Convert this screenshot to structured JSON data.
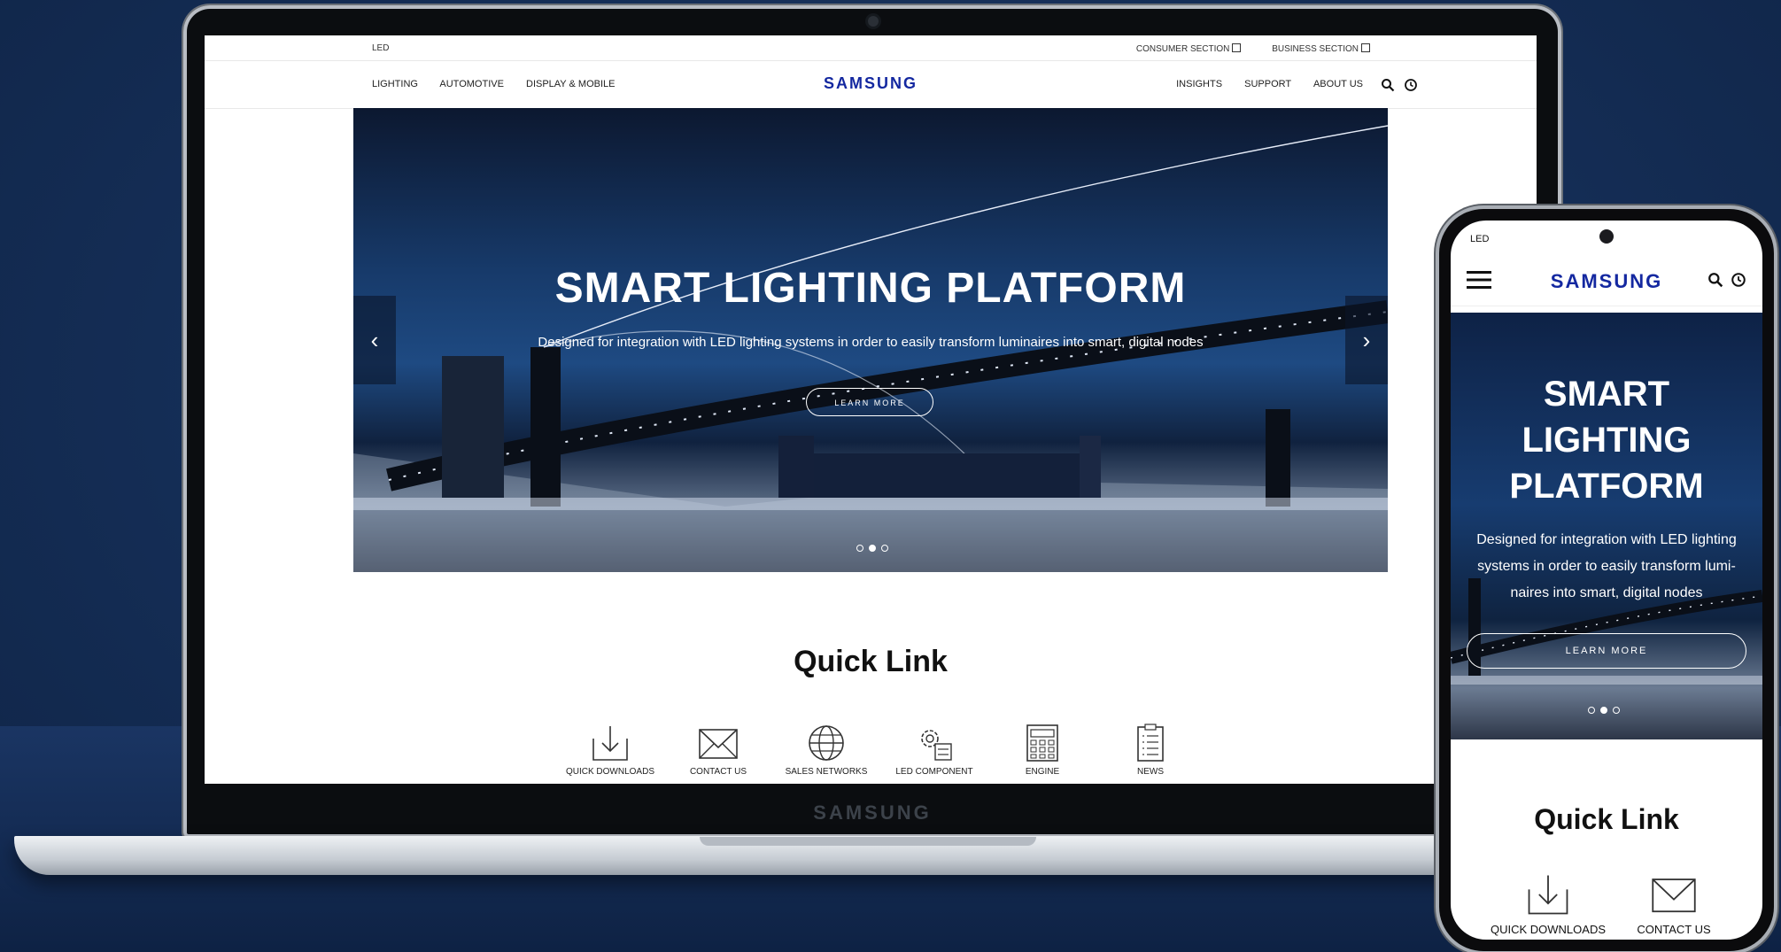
{
  "laptop": {
    "brand_label": "SAMSUNG",
    "topbar": {
      "led_label": "LED",
      "consumer_section": "CONSUMER SECTION",
      "business_section": "BUSINESS SECTION"
    },
    "nav": {
      "left_items": [
        "LIGHTING",
        "AUTOMOTIVE",
        "DISPLAY & MOBILE"
      ],
      "logo": "SAMSUNG",
      "right_items": [
        "INSIGHTS",
        "SUPPORT",
        "ABOUT US"
      ],
      "icons": [
        "search-icon",
        "history-icon"
      ]
    },
    "hero": {
      "title": "SMART LIGHTING PLATFORM",
      "subtitle": "Designed for integration with LED lighting systems in order to easily transform luminaires into smart, digital nodes",
      "cta": "LEARN MORE",
      "prev_glyph": "‹",
      "next_glyph": "›",
      "slide_count": 3,
      "active_slide": 2
    },
    "quick_link": {
      "title": "Quick Link",
      "items": [
        {
          "label": "QUICK DOWNLOADS",
          "icon": "download-icon"
        },
        {
          "label": "CONTACT US",
          "icon": "envelope-icon"
        },
        {
          "label": "SALES NETWORKS",
          "icon": "globe-icon"
        },
        {
          "label": "LED COMPONENT",
          "icon": "gear-calculator-icon"
        },
        {
          "label": "ENGINE",
          "icon": "calculator-icon"
        },
        {
          "label": "NEWS",
          "icon": "clipboard-list-icon"
        }
      ]
    }
  },
  "phone": {
    "led_label": "LED",
    "logo": "SAMSUNG",
    "icons": [
      "menu-icon",
      "search-icon",
      "history-icon"
    ],
    "hero": {
      "title_lines": [
        "SMART",
        "LIGHTING",
        "PLATFORM"
      ],
      "subtitle_lines": [
        "Designed for integration with LED lighting",
        "systems in order to easily transform lumi-",
        "naires into smart, digital nodes"
      ],
      "cta": "LEARN MORE"
    },
    "quick_link": {
      "title": "Quick Link",
      "items": [
        "QUICK DOWNLOADS",
        "CONTACT US"
      ]
    }
  },
  "colors": {
    "brand_blue": "#1428a0",
    "backdrop": "#16305a"
  }
}
